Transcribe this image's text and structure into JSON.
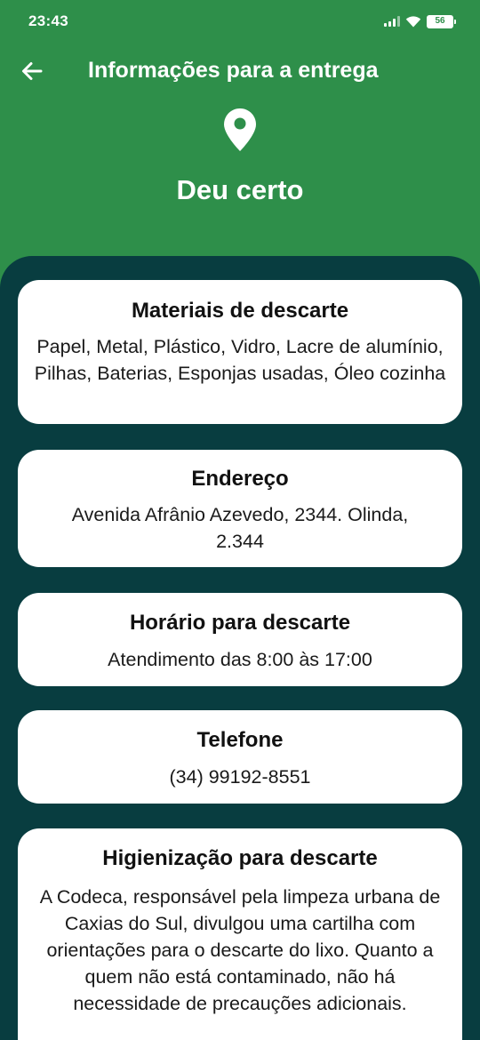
{
  "status_bar": {
    "time": "23:43",
    "battery": "56",
    "icons": [
      "signal-icon",
      "wifi-icon",
      "battery-icon"
    ]
  },
  "header": {
    "back_icon": "arrow-left-icon",
    "title": "Informações para a entrega",
    "pin_icon": "location-pin-icon",
    "subtitle": "Deu certo"
  },
  "cards": {
    "materials": {
      "title": "Materiais de descarte",
      "body": "Papel, Metal, Plástico, Vidro, Lacre de alumínio, Pilhas, Baterias, Esponjas usadas, Óleo cozinha"
    },
    "address": {
      "title": "Endereço",
      "body": "Avenida Afrânio Azevedo, 2344. Olinda, 2.344"
    },
    "hours": {
      "title": "Horário para descarte",
      "body": "Atendimento das 8:00 às 17:00"
    },
    "phone": {
      "title": "Telefone",
      "body": "(34) 99192-8551"
    },
    "hygiene": {
      "title": "Higienização para descarte",
      "body": "A Codeca, responsável pela limpeza urbana de Caxias do Sul, divulgou uma cartilha com orientações para o descarte do lixo. Quanto a quem não está contaminado, não há necessidade de precauções adicionais."
    }
  },
  "colors": {
    "header_bg": "#2e8f4a",
    "panel_bg": "#083d40",
    "card_bg": "#ffffff"
  }
}
